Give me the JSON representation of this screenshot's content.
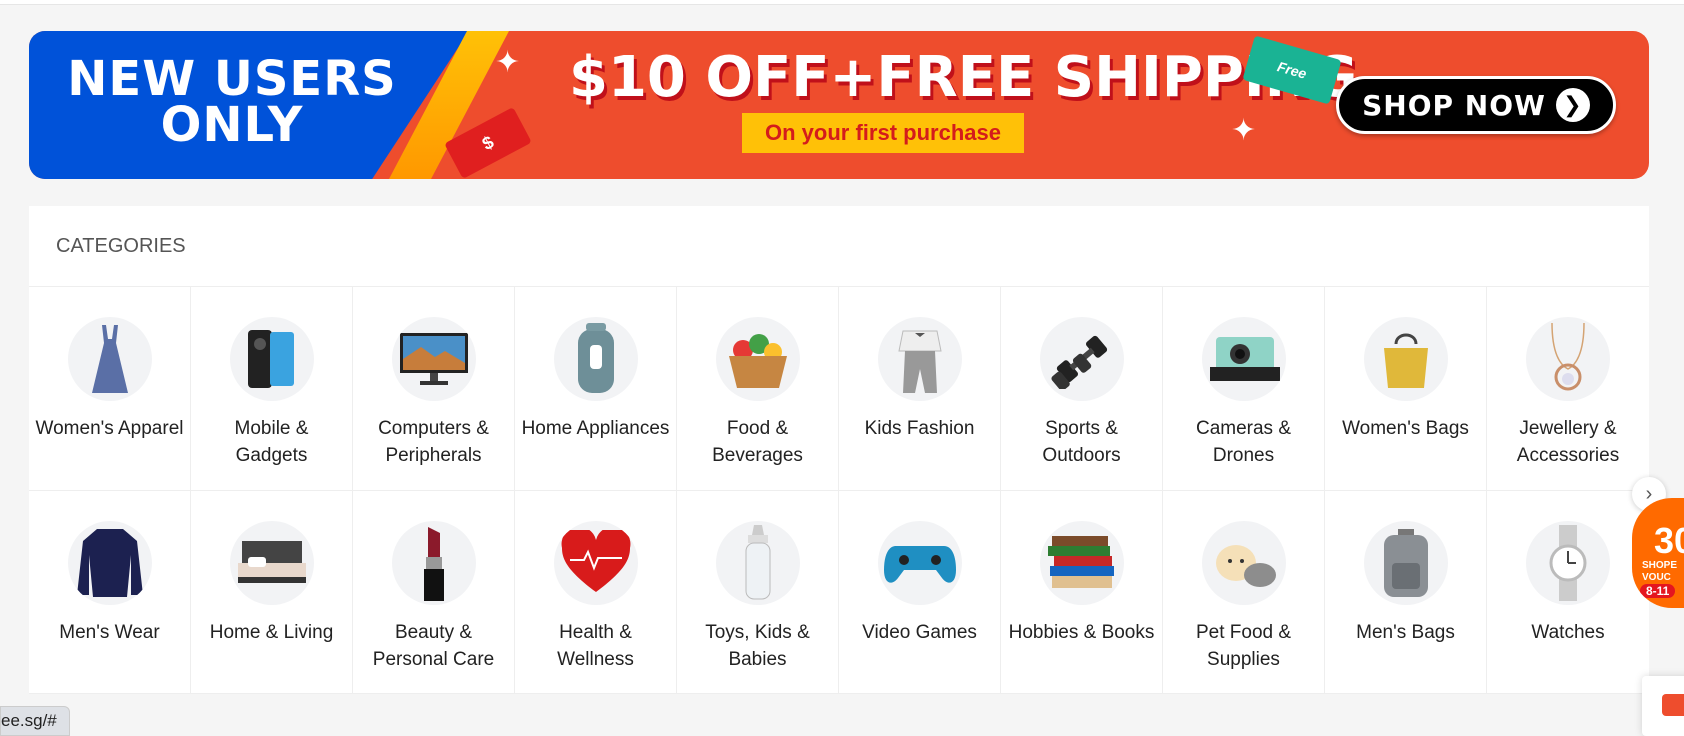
{
  "banner": {
    "left_text": "NEW USERS ONLY",
    "ticket_symbol": "$",
    "headline": "$10 OFF+FREE SHIPPING",
    "subheadline": "On your first purchase",
    "free_tag": "Free",
    "cta": "SHOP NOW",
    "cta_arrow": "❯",
    "colors": {
      "blue": "#0052d9",
      "orange": "#ee4d2d",
      "yellow": "#ffc107"
    }
  },
  "categories": {
    "title": "CATEGORIES",
    "items": [
      {
        "label": "Women's Apparel",
        "icon": "dress-icon"
      },
      {
        "label": "Mobile & Gadgets",
        "icon": "phone-icon"
      },
      {
        "label": "Computers & Peripherals",
        "icon": "monitor-icon"
      },
      {
        "label": "Home Appliances",
        "icon": "air-fryer-icon"
      },
      {
        "label": "Food & Beverages",
        "icon": "fruit-basket-icon"
      },
      {
        "label": "Kids Fashion",
        "icon": "kids-outfit-icon"
      },
      {
        "label": "Sports & Outdoors",
        "icon": "dumbbell-icon"
      },
      {
        "label": "Cameras & Drones",
        "icon": "camera-icon"
      },
      {
        "label": "Women's Bags",
        "icon": "handbag-icon"
      },
      {
        "label": "Jewellery & Accessories",
        "icon": "necklace-icon"
      },
      {
        "label": "Men's Wear",
        "icon": "hoodie-icon"
      },
      {
        "label": "Home & Living",
        "icon": "bed-icon"
      },
      {
        "label": "Beauty & Personal Care",
        "icon": "lipstick-icon"
      },
      {
        "label": "Health & Wellness",
        "icon": "heart-icon"
      },
      {
        "label": "Toys, Kids & Babies",
        "icon": "baby-bottle-icon"
      },
      {
        "label": "Video Games",
        "icon": "gamepad-icon"
      },
      {
        "label": "Hobbies & Books",
        "icon": "books-icon"
      },
      {
        "label": "Pet Food & Supplies",
        "icon": "pets-icon"
      },
      {
        "label": "Men's Bags",
        "icon": "backpack-icon"
      },
      {
        "label": "Watches",
        "icon": "watch-icon"
      }
    ]
  },
  "next_arrow": "›",
  "voucher": {
    "big": "30",
    "small": "SHOPE VOUC",
    "date": "8-11"
  },
  "status_url": "ee.sg/#"
}
